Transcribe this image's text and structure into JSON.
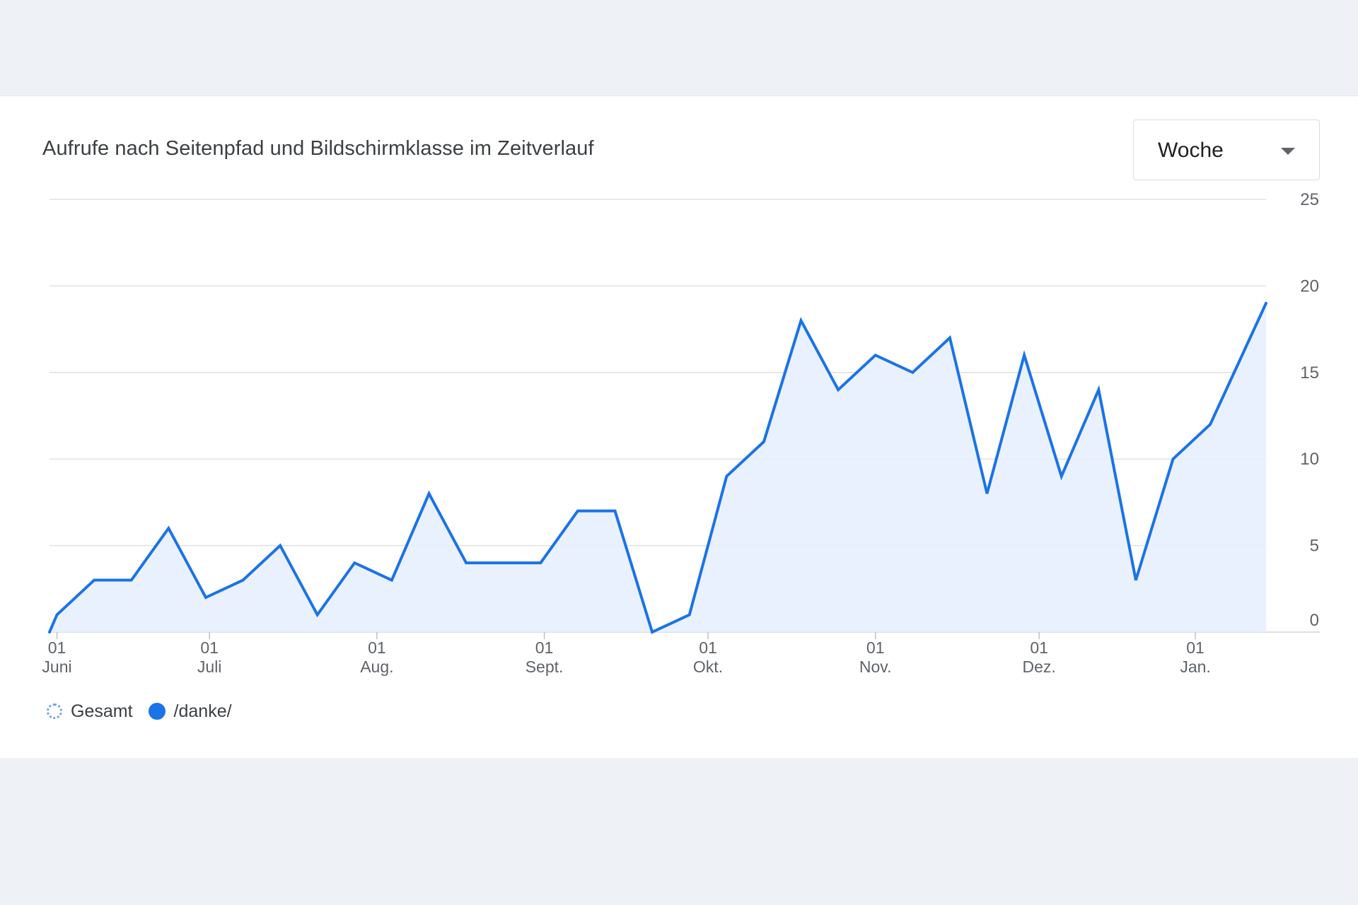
{
  "card": {
    "title": "Aufrufe nach Seitenpfad und Bildschirmklasse im Zeitverlauf",
    "dropdown": {
      "selected": "Woche",
      "icon": "arrow-drop-down-icon"
    }
  },
  "legend": [
    {
      "label": "Gesamt",
      "icon": "dotted-circle-icon",
      "color": "#6fa4ee"
    },
    {
      "label": "/danke/",
      "icon": "filled-circle-icon",
      "color": "#1a73e8"
    }
  ],
  "colors": {
    "line": "#1a73e8",
    "area": "#e8f0fe",
    "grid": "#e0e0e0",
    "background": "#eef2f7"
  },
  "chart_data": {
    "type": "area",
    "title": "Aufrufe nach Seitenpfad und Bildschirmklasse im Zeitverlauf",
    "xlabel": "",
    "ylabel": "",
    "ylim": [
      0,
      25
    ],
    "y_ticks": [
      0,
      5,
      10,
      15,
      20,
      25
    ],
    "y_axis_position": "right",
    "grid": true,
    "legend_position": "bottom-left",
    "x_axis": {
      "start_week": 0,
      "end_week": 32.7,
      "tick_labels": [
        {
          "week": 0.2,
          "day": "01",
          "month": "Juni"
        },
        {
          "week": 4.3,
          "day": "01",
          "month": "Juli"
        },
        {
          "week": 8.8,
          "day": "01",
          "month": "Aug."
        },
        {
          "week": 13.3,
          "day": "01",
          "month": "Sept."
        },
        {
          "week": 17.7,
          "day": "01",
          "month": "Okt."
        },
        {
          "week": 22.2,
          "day": "01",
          "month": "Nov."
        },
        {
          "week": 26.6,
          "day": "01",
          "month": "Dez."
        },
        {
          "week": 30.8,
          "day": "01",
          "month": "Jan."
        }
      ]
    },
    "series": [
      {
        "name": "/danke/",
        "x": [
          0,
          0.2,
          1.2,
          2.2,
          3.2,
          4.2,
          5.2,
          6.2,
          7.2,
          8.2,
          9.2,
          10.2,
          11.2,
          12.2,
          13.2,
          14.2,
          15.2,
          16.2,
          17.2,
          18.2,
          19.2,
          20.2,
          21.2,
          22.2,
          23.2,
          24.2,
          25.2,
          26.2,
          27.2,
          28.2,
          29.2,
          30.2,
          31.2,
          32.7
        ],
        "values": [
          0,
          1,
          3,
          3,
          6,
          2,
          3,
          5,
          1,
          4,
          3,
          8,
          4,
          4,
          4,
          7,
          7,
          0,
          1,
          9,
          11,
          18,
          14,
          16,
          15,
          17,
          8,
          16,
          9,
          14,
          3,
          10,
          12,
          19
        ]
      }
    ]
  }
}
